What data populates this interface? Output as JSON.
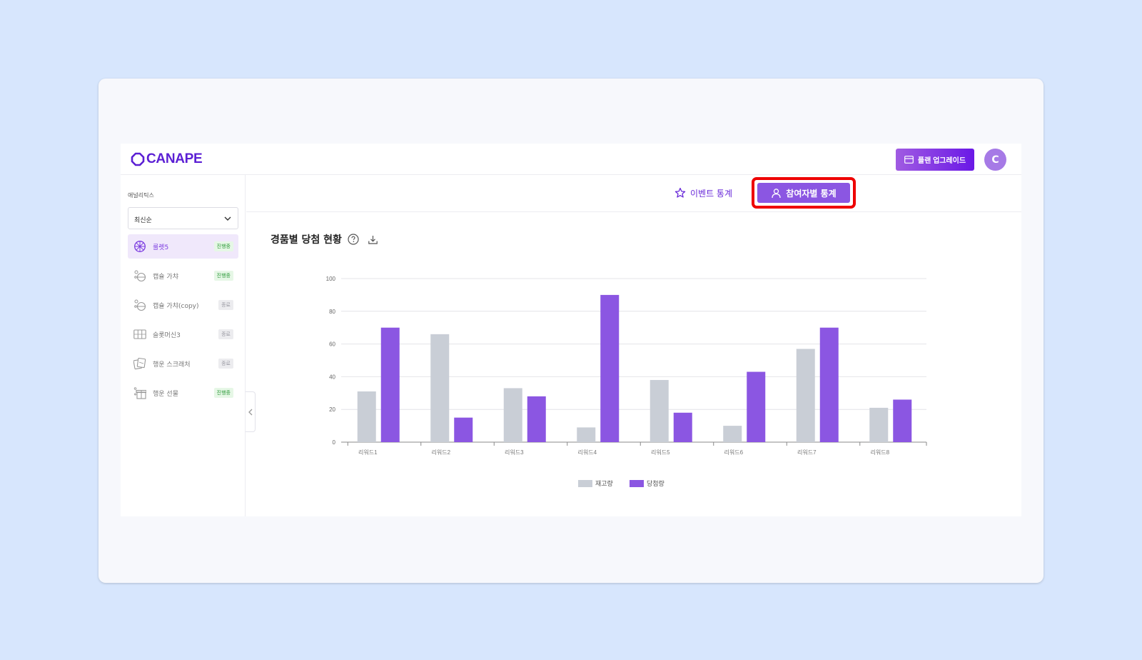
{
  "header": {
    "logo_text": "CANAPE",
    "upgrade_label": "플랜 업그레이드",
    "avatar_letter": "C"
  },
  "sidebar": {
    "title": "애널리틱스",
    "sort": {
      "value": "최신순"
    },
    "items": [
      {
        "label": "룰렛5",
        "status": "진행중",
        "icon": "roulette-icon"
      },
      {
        "label": "캡슐 가챠",
        "status": "진행중",
        "icon": "capsule-icon"
      },
      {
        "label": "캡슐 가챠(copy)",
        "status": "종료",
        "icon": "capsule-icon"
      },
      {
        "label": "슬롯머신3",
        "status": "종료",
        "icon": "slot-machine-icon"
      },
      {
        "label": "행운 스크래처",
        "status": "종료",
        "icon": "scratcher-icon"
      },
      {
        "label": "행운 선물",
        "status": "진행중",
        "icon": "gift-icon"
      }
    ]
  },
  "tabs": {
    "event_stats": "이벤트 통계",
    "participant_stats": "참여자별 통계"
  },
  "main": {
    "chart_title": "경품별 당첨 현황"
  },
  "colors": {
    "accent": "#7b3be0",
    "highlight": "#ee0000",
    "stock": "#c9ced6",
    "wins": "#8b56e2"
  },
  "chart_data": {
    "type": "bar",
    "categories": [
      "리워드1",
      "리워드2",
      "리워드3",
      "리워드4",
      "리워드5",
      "리워드6",
      "리워드7",
      "리워드8"
    ],
    "series": [
      {
        "name": "재고량",
        "values": [
          31,
          66,
          33,
          9,
          38,
          10,
          57,
          21
        ]
      },
      {
        "name": "당첨량",
        "values": [
          70,
          15,
          28,
          90,
          18,
          43,
          70,
          26
        ]
      }
    ],
    "ylim": [
      0,
      100
    ],
    "yticks": [
      0,
      20,
      40,
      60,
      80,
      100
    ],
    "grid": true,
    "legend": "bottom-center"
  }
}
